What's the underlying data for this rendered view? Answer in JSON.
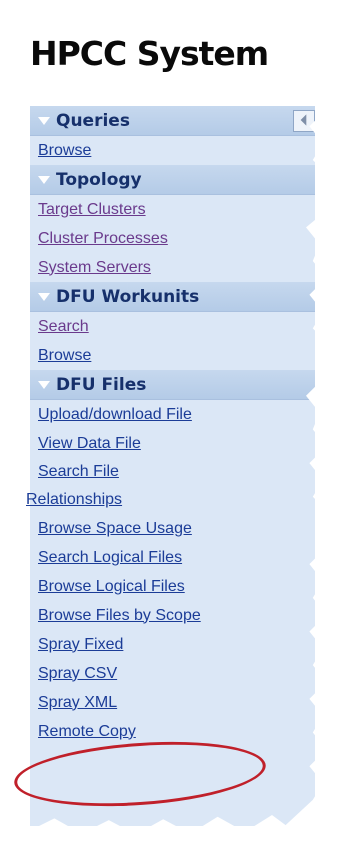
{
  "app": {
    "title": "HPCC System"
  },
  "sections": [
    {
      "title": "Queries",
      "collapse_glyph": "⏴",
      "items": [
        {
          "label": "Browse",
          "visited": false
        }
      ]
    },
    {
      "title": "Topology",
      "items": [
        {
          "label": "Target Clusters",
          "visited": true
        },
        {
          "label": "Cluster Processes",
          "visited": true
        },
        {
          "label": "System Servers",
          "visited": true
        }
      ]
    },
    {
      "title": "DFU Workunits",
      "items": [
        {
          "label": "Search",
          "visited": true
        },
        {
          "label": "Browse",
          "visited": false
        }
      ]
    },
    {
      "title": "DFU Files",
      "items": [
        {
          "label": "Upload/download File",
          "visited": false
        },
        {
          "label": "View Data File",
          "visited": false
        },
        {
          "label": "Search File",
          "visited": false
        },
        {
          "label": "Relationships",
          "visited": false
        },
        {
          "label": "Browse Space Usage",
          "visited": false
        },
        {
          "label": "Search Logical Files",
          "visited": false
        },
        {
          "label": "Browse Logical Files",
          "visited": false
        },
        {
          "label": "Browse Files by Scope",
          "visited": false
        },
        {
          "label": "Spray Fixed",
          "visited": false
        },
        {
          "label": "Spray CSV",
          "visited": false,
          "highlighted": true
        },
        {
          "label": "Spray XML",
          "visited": false
        },
        {
          "label": "Remote Copy",
          "visited": false
        }
      ]
    }
  ],
  "colors": {
    "link": "#1b3c97",
    "visited": "#6a3a8c",
    "section_bg": "#b4cbe7",
    "menu_bg": "#dbe7f6",
    "highlight": "#c0202a"
  }
}
